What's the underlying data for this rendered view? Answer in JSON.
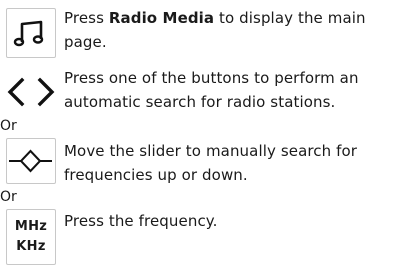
{
  "steps": [
    {
      "icon": "music-note-icon",
      "prefix": "Press ",
      "bold": "Radio Media",
      "suffix": " to display the main page."
    },
    {
      "icon": "left-right-chevrons-icon",
      "text": "Press one of the buttons to perform an automatic search for radio stations."
    },
    {
      "icon": "slider-icon",
      "text": "Move the slider to manually search for frequencies up or down."
    },
    {
      "icon": "frequency-units-icon",
      "unit_top": "MHz",
      "unit_bottom": "KHz",
      "text": "Press the frequency."
    }
  ],
  "or_labels": [
    "Or",
    "Or"
  ]
}
